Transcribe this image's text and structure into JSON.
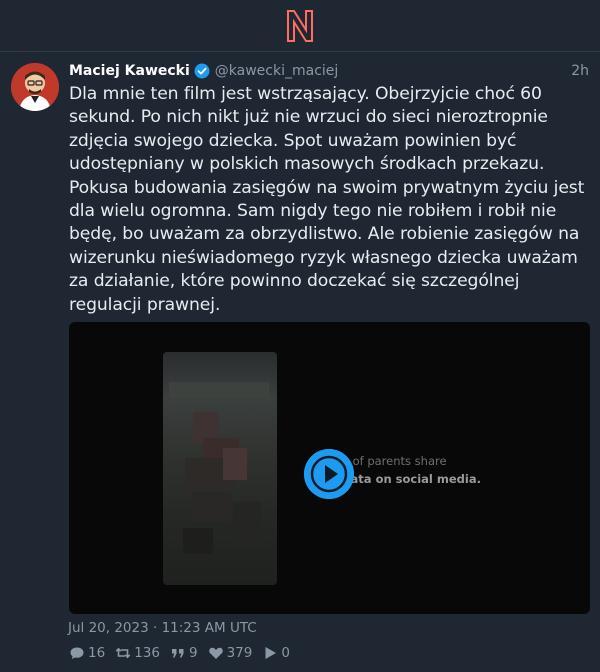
{
  "app": {
    "logo_icon": "nitter-logo-icon",
    "accent": "#ff6c60"
  },
  "tweet": {
    "author_name": "Maciej Kawecki",
    "verified_icon": "verified-badge-icon",
    "handle": "@kawecki_maciej",
    "relative_time": "2h",
    "text": "Dla mnie ten film jest wstrząsający. Obejrzyjcie choć 60 sekund. Po nich nikt już nie wrzuci do sieci nieroztropnie zdjęcia swojego dziecka. Spot uważam powinien być udostępniany w polskich masowych środkach przekazu. Pokusa budowania zasięgów na swoim prywatnym życiu jest dla wielu ogromna. Sam nigdy tego nie robiłem i robił nie będę, bo uważam za obrzydlistwo. Ale robienie zasięgów na wizerunku nieświadomego ryzyk własnego dziecka uważam za działanie, które powinno doczekać się szczególnej regulacji prawnej.",
    "video": {
      "overlay_line1": "% of parents share",
      "overlay_line2": "ls' data on social media.",
      "play_icon": "play-icon"
    },
    "date": "Jul 20, 2023 · 11:23 AM UTC",
    "stats": {
      "replies": "16",
      "retweets": "136",
      "quotes": "9",
      "likes": "379",
      "views": "0"
    }
  }
}
